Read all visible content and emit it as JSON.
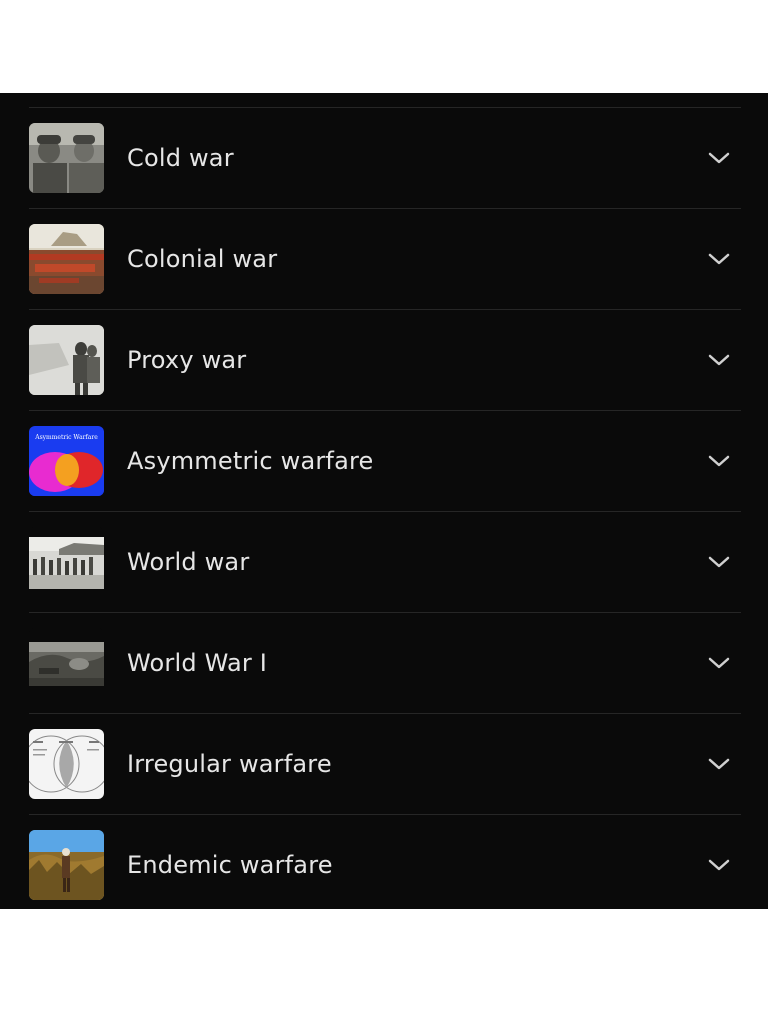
{
  "list": {
    "items": [
      {
        "label": "Cold war",
        "thumb_icon": "cold-war-thumbnail"
      },
      {
        "label": "Colonial war",
        "thumb_icon": "colonial-war-thumbnail"
      },
      {
        "label": "Proxy war",
        "thumb_icon": "proxy-war-thumbnail"
      },
      {
        "label": "Asymmetric warfare",
        "thumb_icon": "asymmetric-warfare-thumbnail",
        "thumb_text": "Asymmetric Warfare"
      },
      {
        "label": "World war",
        "thumb_icon": "world-war-thumbnail"
      },
      {
        "label": "World War I",
        "thumb_icon": "world-war-i-thumbnail"
      },
      {
        "label": "Irregular warfare",
        "thumb_icon": "irregular-warfare-thumbnail"
      },
      {
        "label": "Endemic warfare",
        "thumb_icon": "endemic-warfare-thumbnail"
      }
    ],
    "expand_icon": "chevron-down-icon"
  },
  "colors": {
    "panel_bg": "#0a0a0a",
    "divider": "#262626",
    "text": "#e6e6e6",
    "page_bg": "#ffffff"
  }
}
